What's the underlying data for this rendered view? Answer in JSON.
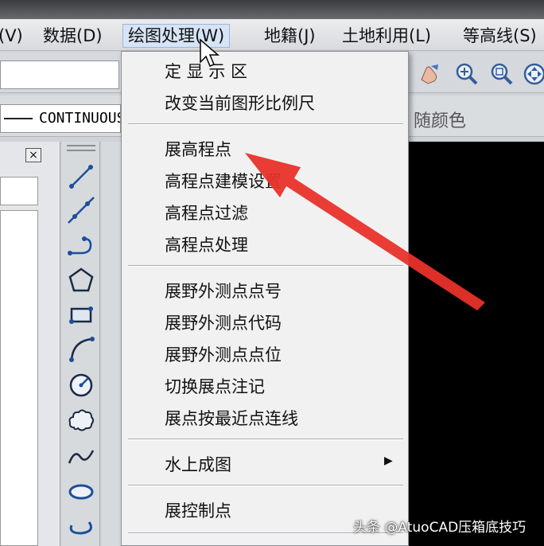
{
  "menubar": {
    "items": [
      {
        "label": "(V)"
      },
      {
        "label": "数据(D)"
      },
      {
        "label": "绘图处理(W)"
      },
      {
        "label": "地籍(J)"
      },
      {
        "label": "土地利用(L)"
      },
      {
        "label": "等高线(S)"
      }
    ]
  },
  "toolbar": {
    "linetype_value": "CONTINUOUS",
    "color_value": "随颜色",
    "icons": [
      "pan-hand-icon",
      "zoom-realtime-icon",
      "zoom-window-icon",
      "orbit-icon"
    ]
  },
  "left_panel": {
    "close_label": "×"
  },
  "draw_toolbar": {
    "icons": [
      "line-icon",
      "construction-line-icon",
      "polyline-icon",
      "polygon-icon",
      "rectangle-icon",
      "arc-icon",
      "circle-icon",
      "revision-cloud-icon",
      "spline-icon",
      "ellipse-icon",
      "ellipse-arc-icon"
    ]
  },
  "dropdown": {
    "groups": [
      [
        "定 显 示 区",
        "改变当前图形比例尺"
      ],
      [
        "展高程点",
        "高程点建模设置",
        "高程点过滤",
        "高程点处理"
      ],
      [
        "展野外测点点号",
        "展野外测点代码",
        "展野外测点点位",
        "切换展点注记",
        "展点按最近点连线"
      ],
      [
        "水上成图"
      ],
      [
        "展控制点"
      ]
    ],
    "submenu_arrow": "▶"
  },
  "colors": {
    "annotation_arrow": "#e8312a",
    "menu_bg": "#f1f1f2",
    "canvas_bg": "#000000"
  },
  "watermark": "头条 @AtuoCAD压箱底技巧"
}
